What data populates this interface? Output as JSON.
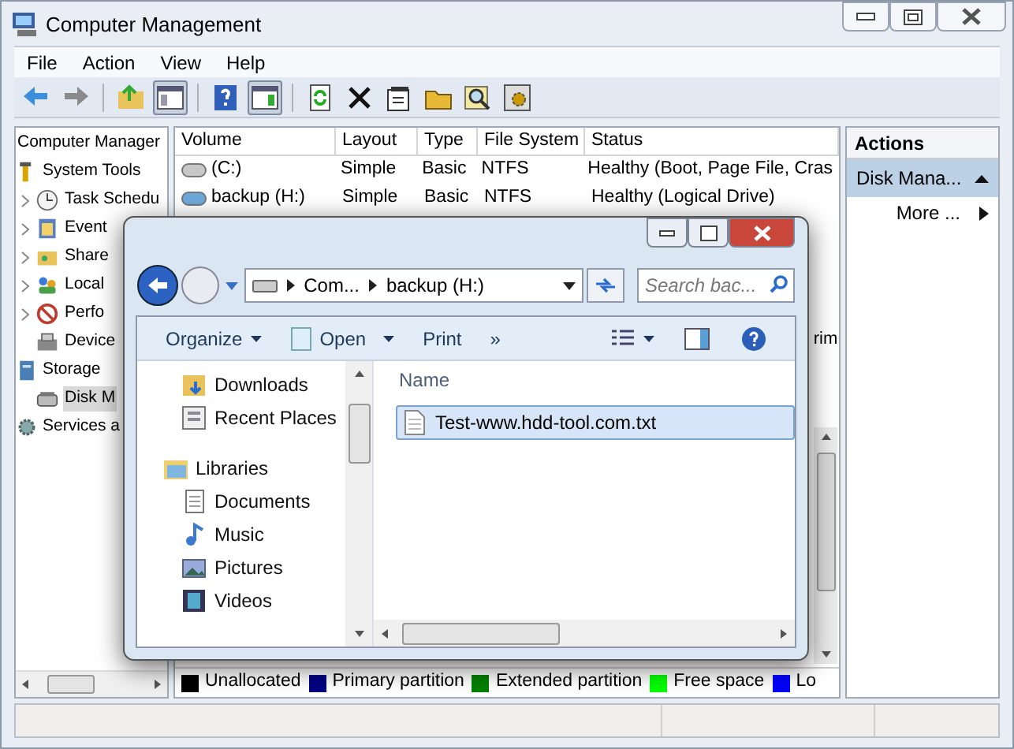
{
  "window": {
    "title": "Computer Management"
  },
  "menu": [
    "File",
    "Action",
    "View",
    "Help"
  ],
  "toolbar": [
    {
      "kind": "back",
      "pressed": false
    },
    {
      "kind": "forward",
      "pressed": false
    },
    {
      "kind": "up",
      "pressed": false
    },
    {
      "kind": "tree",
      "pressed": true
    },
    {
      "kind": "help",
      "pressed": false
    },
    {
      "kind": "pane",
      "pressed": true
    },
    {
      "kind": "refresh",
      "pressed": false
    },
    {
      "kind": "delete",
      "pressed": false
    },
    {
      "kind": "properties",
      "pressed": false
    },
    {
      "kind": "open",
      "pressed": false
    },
    {
      "kind": "find",
      "pressed": false
    },
    {
      "kind": "settings",
      "pressed": false
    }
  ],
  "tree": {
    "label": "Computer Manager",
    "children": [
      {
        "label": "System Tools",
        "expanded": true,
        "children": [
          {
            "label": "Task Schedu",
            "expanded": false
          },
          {
            "label": "Event",
            "expanded": false
          },
          {
            "label": "Share",
            "expanded": false
          },
          {
            "label": "Local",
            "expanded": false
          },
          {
            "label": "Perfo",
            "expanded": false
          },
          {
            "label": "Device"
          }
        ]
      },
      {
        "label": "Storage",
        "expanded": true,
        "children": [
          {
            "label": "Disk M",
            "selected": true
          }
        ]
      },
      {
        "label": "Services a"
      }
    ]
  },
  "volumes": {
    "columns": [
      "Volume",
      "Layout",
      "Type",
      "File System",
      "Status"
    ],
    "rows": [
      {
        "volume": "(C:)",
        "layout": "Simple",
        "type": "Basic",
        "file_system": "NTFS",
        "status": "Healthy (Boot, Page File, Cras"
      },
      {
        "volume": "backup (H:)",
        "layout": "Simple",
        "type": "Basic",
        "file_system": "NTFS",
        "status": "Healthy (Logical Drive)"
      }
    ]
  },
  "disk_fragment": "rim",
  "legend": [
    {
      "label": "Unallocated",
      "color": "#000000"
    },
    {
      "label": "Primary partition",
      "color": "#000080"
    },
    {
      "label": "Extended partition",
      "color": "#008000"
    },
    {
      "label": "Free space",
      "color": "#00ff00"
    },
    {
      "label": "Lo",
      "color": "#0000ff"
    }
  ],
  "actions": {
    "title": "Actions",
    "section": "Disk Mana...",
    "items": [
      "More ..."
    ]
  },
  "explorer": {
    "breadcrumb": [
      "Com...",
      "backup (H:)"
    ],
    "search_placeholder": "Search bac...",
    "commands": [
      {
        "label": "Organize",
        "kind": "menu"
      },
      {
        "label": "Open",
        "kind": "split"
      },
      {
        "label": "Print",
        "kind": "plain"
      },
      {
        "label": "»",
        "kind": "plain"
      }
    ],
    "nav": [
      {
        "label": "Downloads",
        "kind": "item"
      },
      {
        "label": "Recent Places",
        "kind": "item"
      },
      {
        "label": "Libraries",
        "kind": "group"
      },
      {
        "label": "Documents",
        "kind": "item"
      },
      {
        "label": "Music",
        "kind": "item"
      },
      {
        "label": "Pictures",
        "kind": "item"
      },
      {
        "label": "Videos",
        "kind": "item"
      }
    ],
    "column": "Name",
    "files": [
      {
        "name": "Test-www.hdd-tool.com.txt",
        "selected": true
      }
    ]
  }
}
